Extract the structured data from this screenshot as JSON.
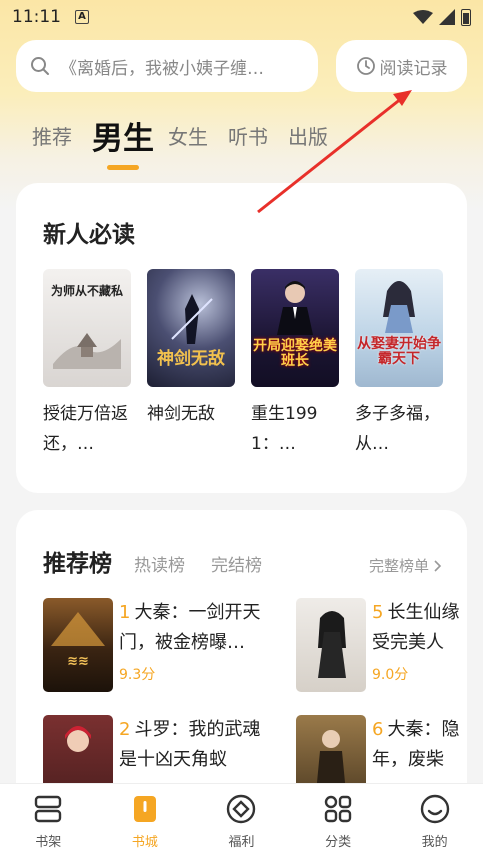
{
  "status": {
    "time": "11:11",
    "notification_badge": "A"
  },
  "search": {
    "placeholder": "《离婚后，我被小姨子缠…",
    "history_label": "阅读记录"
  },
  "tabs": [
    {
      "label": "推荐",
      "active": false
    },
    {
      "label": "男生",
      "active": true
    },
    {
      "label": "女生",
      "active": false
    },
    {
      "label": "听书",
      "active": false
    },
    {
      "label": "出版",
      "active": false
    }
  ],
  "new_reader": {
    "title": "新人必读",
    "books": [
      {
        "title": "授徒万倍返还，…",
        "cover_text": "为师从不藏私",
        "cover_color": "#e9e6e4"
      },
      {
        "title": "神剑无敌",
        "cover_text": "神剑无敌",
        "cover_color": "#3a3d5a"
      },
      {
        "title": "重生1991：…",
        "cover_text": "开局迎娶绝美班长",
        "cover_color": "#2b2146"
      },
      {
        "title": "多子多福，从…",
        "cover_text": "从娶妻开始争霸天下",
        "cover_color": "#cfe0ee"
      }
    ]
  },
  "ranking": {
    "title": "推荐榜",
    "tabs": [
      "热读榜",
      "完结榜"
    ],
    "all_label": "完整榜单",
    "items": [
      {
        "rank": "1",
        "line1": "大秦：一剑开天",
        "line2": "门，被金榜曝…",
        "score": "9.3分",
        "cover_color": "#3a2a1a"
      },
      {
        "rank": "5",
        "line1": "长生仙缘",
        "line2": "受完美人",
        "score": "9.0分",
        "cover_color": "#e4e0da"
      },
      {
        "rank": "2",
        "line1": "斗罗：我的武魂",
        "line2": "是十凶天角蚁",
        "score": "",
        "cover_color": "#5a2a2a"
      },
      {
        "rank": "6",
        "line1": "大秦：隐",
        "line2": "年，废柴",
        "score": "",
        "cover_color": "#4a3a28"
      }
    ]
  },
  "bottom_nav": [
    {
      "label": "书架",
      "icon": "bookshelf-icon",
      "active": false
    },
    {
      "label": "书城",
      "icon": "bookstore-icon",
      "active": true
    },
    {
      "label": "福利",
      "icon": "welfare-icon",
      "active": false
    },
    {
      "label": "分类",
      "icon": "category-icon",
      "active": false
    },
    {
      "label": "我的",
      "icon": "profile-icon",
      "active": false
    }
  ],
  "colors": {
    "accent": "#f5a623",
    "arrow": "#e8302a"
  }
}
